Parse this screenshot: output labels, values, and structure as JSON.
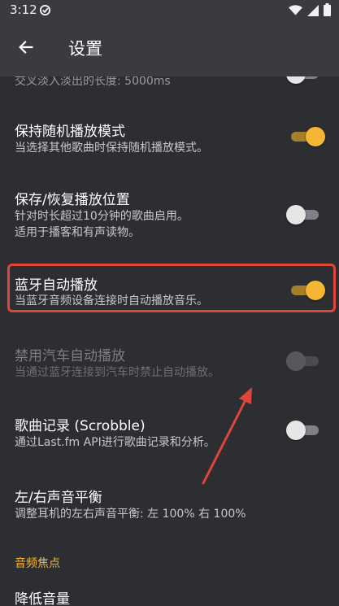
{
  "status_bar": {
    "time": "3:12",
    "icons": [
      "sync-icon",
      "wifi-icon",
      "signal-icon",
      "battery-icon"
    ]
  },
  "app_bar": {
    "title": "设置",
    "back_icon": "arrow-left-icon"
  },
  "partial_item": {
    "summary": "交叉淡入淡出的长度: 5000ms"
  },
  "prefs": [
    {
      "title": "保持随机播放模式",
      "summary": "当选择其他歌曲时保持随机播放模式。",
      "checked": true,
      "enabled": true
    },
    {
      "title": "保存/恢复播放位置",
      "summary_lines": [
        "针对时长超过10分钟的歌曲启用。",
        "适用于播客和有声读物。"
      ],
      "checked": false,
      "enabled": true
    },
    {
      "title": "蓝牙自动播放",
      "summary": "当蓝牙音频设备连接时自动播放音乐。",
      "checked": true,
      "enabled": true,
      "highlighted": true
    },
    {
      "title": "禁用汽车自动播放",
      "summary": "当通过蓝牙连接到汽车时禁止自动播放。",
      "checked": false,
      "enabled": false
    },
    {
      "title": "歌曲记录 (Scrobble)",
      "summary": "通过Last.fm API进行歌曲记录和分析。",
      "checked": false,
      "enabled": true
    },
    {
      "title": "左/右声音平衡",
      "summary": "调整耳机的左右声音平衡: 左 100% 右 100%"
    }
  ],
  "section": {
    "header": "音频焦点"
  },
  "last_pref": {
    "title": "降低音量"
  },
  "colors": {
    "background": "#2d2e31",
    "app_bar": "#3a3b3f",
    "accent": "#f5b634",
    "annotation": "#e0443a"
  }
}
